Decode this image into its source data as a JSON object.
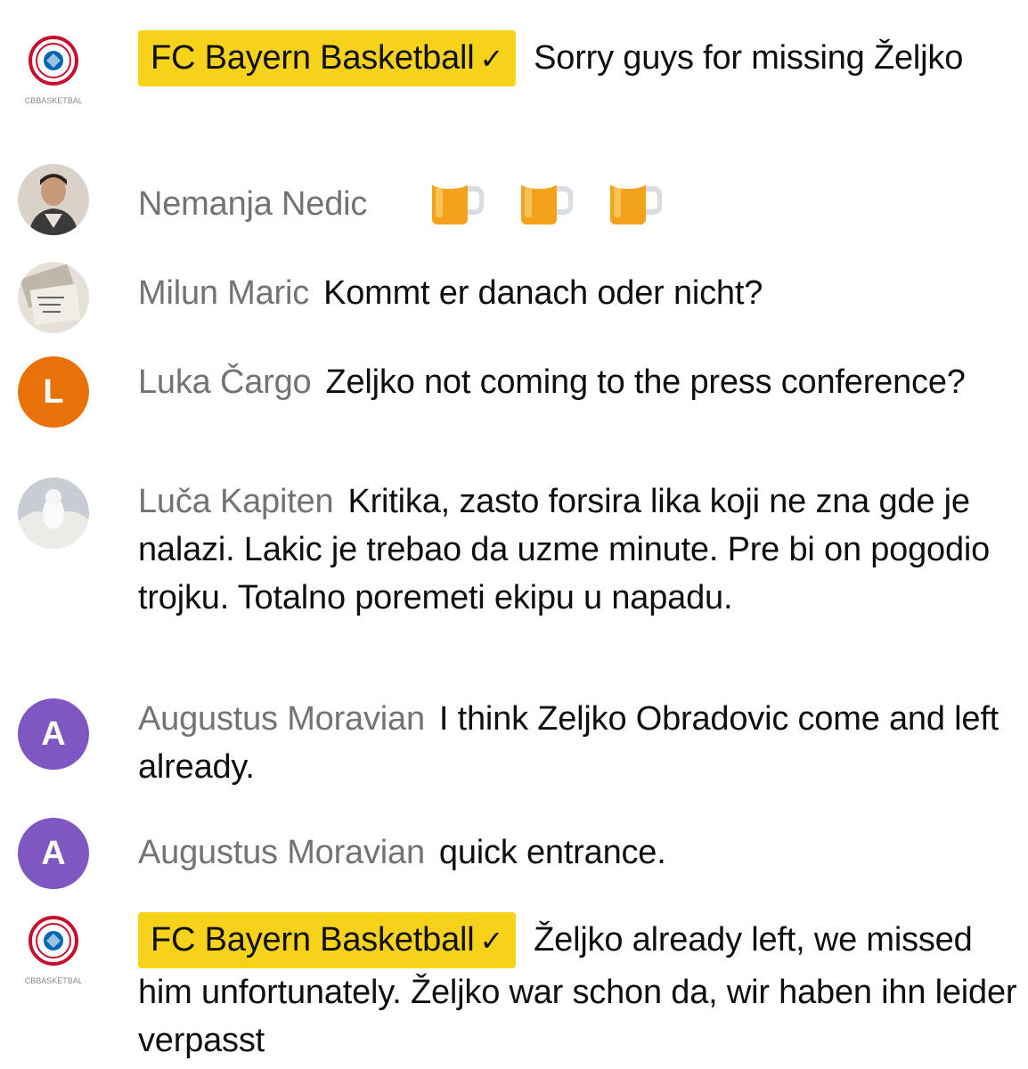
{
  "messages": [
    {
      "author": "FC Bayern Basketball",
      "verified": true,
      "text": "Sorry guys for missing Željko",
      "avatar": "club-logo"
    },
    {
      "author": "Nemanja Nedic",
      "verified": false,
      "text": "",
      "emojis": [
        "beer-mug-icon",
        "beer-mug-icon",
        "beer-mug-icon"
      ],
      "avatar": "photo"
    },
    {
      "author": "Milun Maric",
      "verified": false,
      "text": "Kommt er danach oder nicht?",
      "avatar": "photo"
    },
    {
      "author": "Luka Čargo",
      "verified": false,
      "text": "Zeljko not coming to the press conference?",
      "avatar_letter": "L",
      "avatar_color": "#e8710a"
    },
    {
      "author": "Luča Kapiten",
      "verified": false,
      "text": "Kritika, zasto forsira lika koji ne zna gde je nalazi. Lakic je trebao da uzme minute. Pre bi on pogodio trojku. Totalno poremeti ekipu u napadu.",
      "avatar": "photo"
    },
    {
      "author": "Augustus Moravian",
      "verified": false,
      "text": "I think Zeljko Obradovic come and left already.",
      "avatar_letter": "A",
      "avatar_color": "#7e57c2"
    },
    {
      "author": "Augustus Moravian",
      "verified": false,
      "text": "quick entrance.",
      "avatar_letter": "A",
      "avatar_color": "#7e57c2"
    },
    {
      "author": "FC Bayern Basketball",
      "verified": true,
      "text": "Željko already left, we missed him unfortunately. Željko war schon da, wir haben ihn leider verpasst",
      "avatar": "club-logo"
    }
  ],
  "club_logo_caption": "FCBBASKETBALL",
  "colors": {
    "badge": "#f6d21a",
    "author": "#737373",
    "text": "#0f0f0f"
  }
}
